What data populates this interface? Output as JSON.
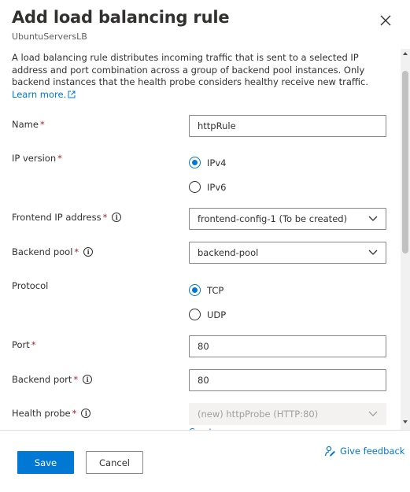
{
  "header": {
    "title": "Add load balancing rule",
    "subtitle": "UbuntuServersLB",
    "close_icon": "close-icon"
  },
  "description": {
    "text": "A load balancing rule distributes incoming traffic that is sent to a selected IP address and port combination across a group of backend pool instances. Only backend instances that the health probe considers healthy receive new traffic.",
    "link_text": "Learn more.",
    "link_icon": "external-link-icon"
  },
  "form": {
    "name": {
      "label": "Name",
      "required": "*",
      "value": "httpRule"
    },
    "ip_version": {
      "label": "IP version",
      "required": "*",
      "options": [
        "IPv4",
        "IPv6"
      ],
      "selected": "IPv4"
    },
    "frontend_ip": {
      "label": "Frontend IP address",
      "required": "*",
      "info": "i",
      "value": "frontend-config-1 (To be created)"
    },
    "backend_pool": {
      "label": "Backend pool",
      "required": "*",
      "info": "i",
      "value": "backend-pool"
    },
    "protocol": {
      "label": "Protocol",
      "options": [
        "TCP",
        "UDP"
      ],
      "selected": "TCP"
    },
    "port": {
      "label": "Port",
      "required": "*",
      "value": "80"
    },
    "backend_port": {
      "label": "Backend port",
      "required": "*",
      "info": "i",
      "value": "80"
    },
    "health_probe": {
      "label": "Health probe",
      "required": "*",
      "info": "i",
      "value": "(new) httpProbe (HTTP:80)",
      "disabled": true,
      "create_link": "Create new"
    }
  },
  "footer": {
    "save_label": "Save",
    "cancel_label": "Cancel",
    "feedback_label": "Give feedback",
    "feedback_icon": "feedback-person-icon"
  },
  "colors": {
    "accent": "#0078d4",
    "required": "#a4262c",
    "text": "#323130",
    "subtle_text": "#605e5c",
    "disabled_bg": "#f3f2f1"
  }
}
